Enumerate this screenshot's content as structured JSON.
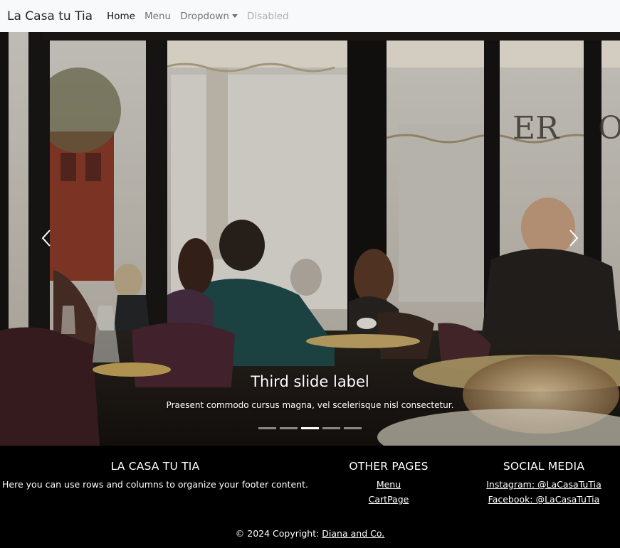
{
  "navbar": {
    "brand": "La Casa tu Tia",
    "links": [
      {
        "label": "Home",
        "state": "active"
      },
      {
        "label": "Menu",
        "state": "normal"
      },
      {
        "label": "Dropdown",
        "state": "dropdown"
      },
      {
        "label": "Disabled",
        "state": "disabled"
      }
    ]
  },
  "carousel": {
    "caption_title": "Third slide label",
    "caption_text": "Praesent commodo cursus magna, vel scelerisque nisl consectetur.",
    "indicator_count": 5,
    "active_indicator": 3,
    "prev_icon": "chevron-left-icon",
    "next_icon": "chevron-right-icon"
  },
  "footer": {
    "about": {
      "title": "LA CASA TU TIA",
      "text": "Here you can use rows and columns to organize your footer content."
    },
    "pages": {
      "title": "OTHER PAGES",
      "links": [
        "Menu",
        "CartPage"
      ]
    },
    "social": {
      "title": "SOCIAL MEDIA",
      "links": [
        "Instagram: @LaCasaTuTia",
        "Facebook: @LaCasaTuTia"
      ]
    },
    "copyright_prefix": "© 2024 Copyright: ",
    "copyright_link": "Diana and Co."
  },
  "colors": {
    "navbar_bg": "#f8f9fa",
    "footer_bg": "#000000"
  }
}
